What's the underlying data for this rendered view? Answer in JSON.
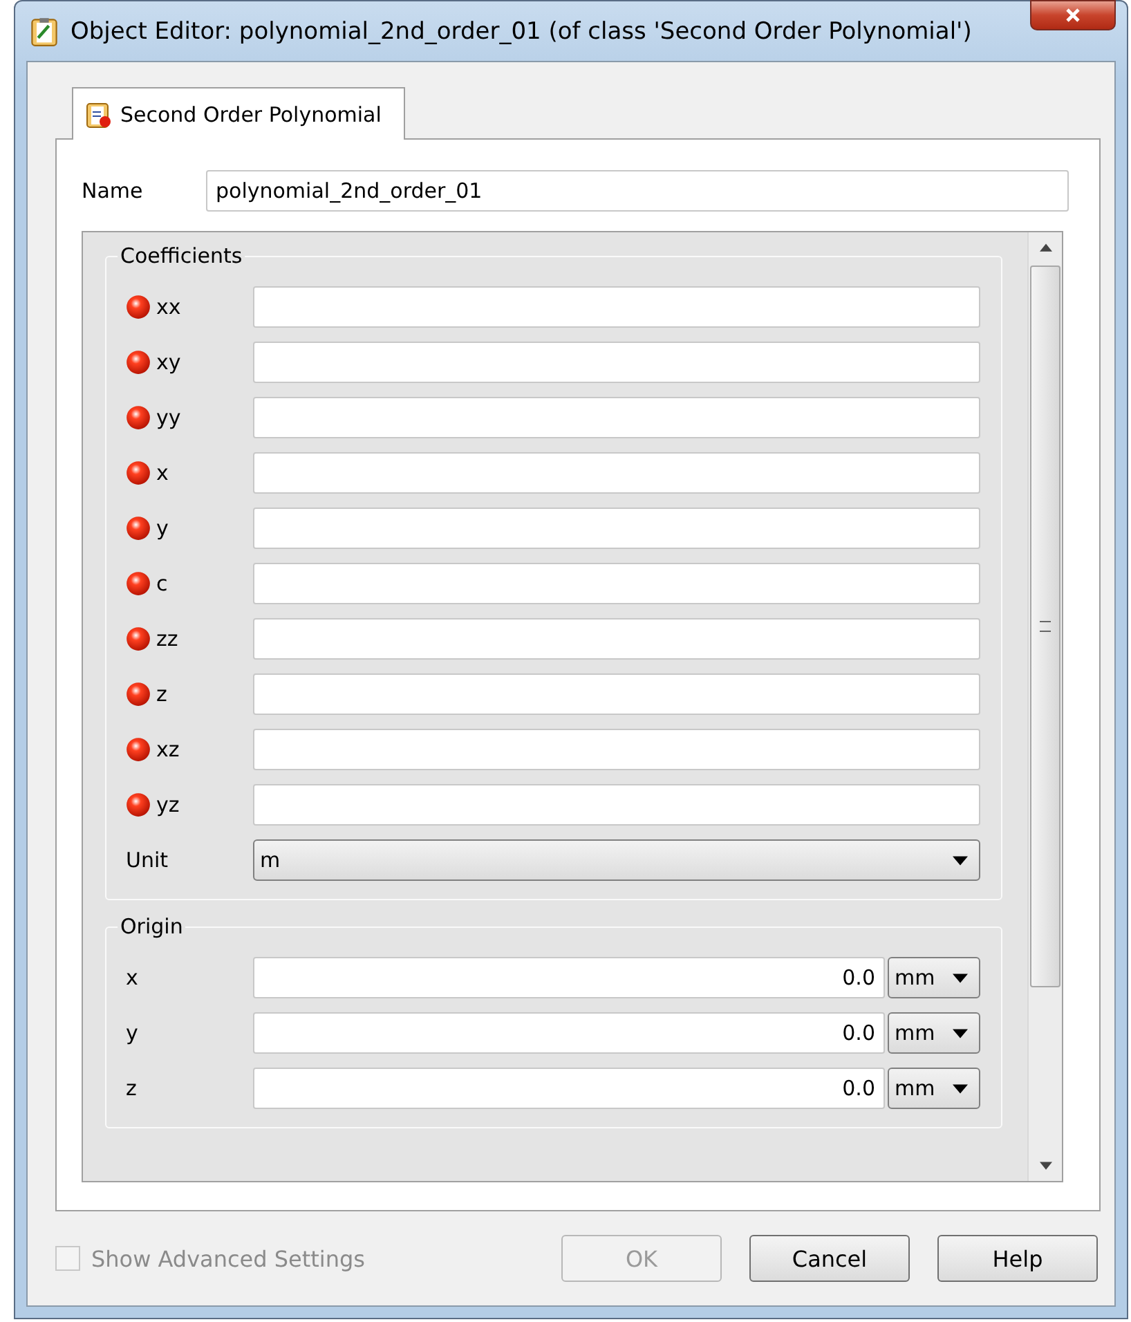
{
  "window": {
    "title": "Object Editor: polynomial_2nd_order_01 (of class 'Second Order Polynomial')"
  },
  "tabs": [
    {
      "label": "Second Order Polynomial",
      "selected": true
    }
  ],
  "name_field": {
    "label": "Name",
    "value": "polynomial_2nd_order_01"
  },
  "coefficients": {
    "title": "Coefficients",
    "rows": [
      {
        "label": "xx",
        "valid": false
      },
      {
        "label": "xy",
        "valid": false
      },
      {
        "label": "yy",
        "valid": false
      },
      {
        "label": "x",
        "valid": false
      },
      {
        "label": "y",
        "valid": false
      },
      {
        "label": "c",
        "valid": false
      },
      {
        "label": "zz",
        "valid": false
      },
      {
        "label": "z",
        "valid": false
      },
      {
        "label": "xz",
        "valid": false
      },
      {
        "label": "yz",
        "valid": false
      }
    ],
    "unit": {
      "label": "Unit",
      "value": "m"
    }
  },
  "origin": {
    "title": "Origin",
    "rows": [
      {
        "label": "x",
        "value": "0.0",
        "unit": "mm"
      },
      {
        "label": "y",
        "value": "0.0",
        "unit": "mm"
      },
      {
        "label": "z",
        "value": "0.0",
        "unit": "mm"
      }
    ]
  },
  "advanced": {
    "label": "Show Advanced Settings",
    "checked": false,
    "disabled": true
  },
  "buttons": [
    {
      "label": "OK",
      "disabled": true
    },
    {
      "label": "Cancel",
      "disabled": false
    },
    {
      "label": "Help",
      "disabled": false
    }
  ]
}
